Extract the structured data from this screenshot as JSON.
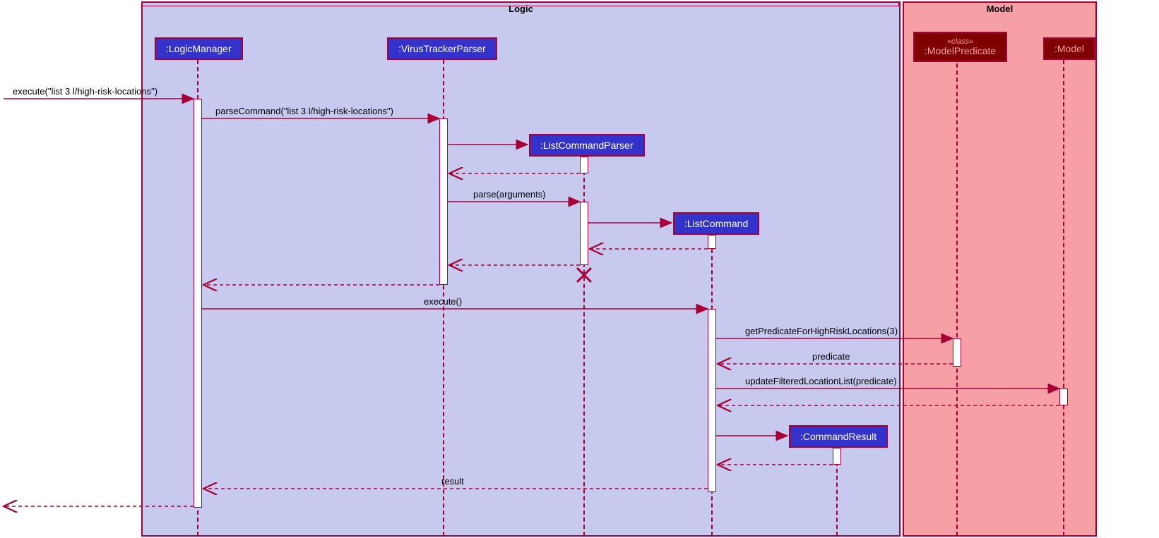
{
  "frames": {
    "logic": {
      "label": "Logic"
    },
    "model": {
      "label": "Model"
    }
  },
  "participants": {
    "logicManager": {
      "label": ":LogicManager"
    },
    "virusTrackerParser": {
      "label": ":VirusTrackerParser"
    },
    "listCommandParser": {
      "label": ":ListCommandParser"
    },
    "listCommand": {
      "label": ":ListCommand"
    },
    "commandResult": {
      "label": ":CommandResult"
    },
    "modelPredicate": {
      "stereotype": "«class»",
      "label": ":ModelPredicate"
    },
    "model": {
      "label": ":Model"
    }
  },
  "messages": {
    "m1": "execute(\"list 3 l/high-risk-locations\")",
    "m2": "parseCommand(\"list 3 l/high-risk-locations\")",
    "m3": "parse(arguments)",
    "m4": "execute()",
    "m5": "getPredicateForHighRiskLocations(3)",
    "m6": "predicate",
    "m7": "updateFilteredLocationList(predicate)",
    "m8": "result"
  },
  "colors": {
    "logicFrameBg": "#c7c9ee",
    "logicFrameBr": "#a80036",
    "logicHeadBg": "#3333cc",
    "logicHeadFg": "#ffffff",
    "modelFrameBg": "#f6a0a6",
    "modelFrameBr": "#a80036",
    "modelHeadBg": "#800000",
    "modelHeadFg": "#f6a0a6",
    "line": "#a80036",
    "text": "#000000"
  }
}
